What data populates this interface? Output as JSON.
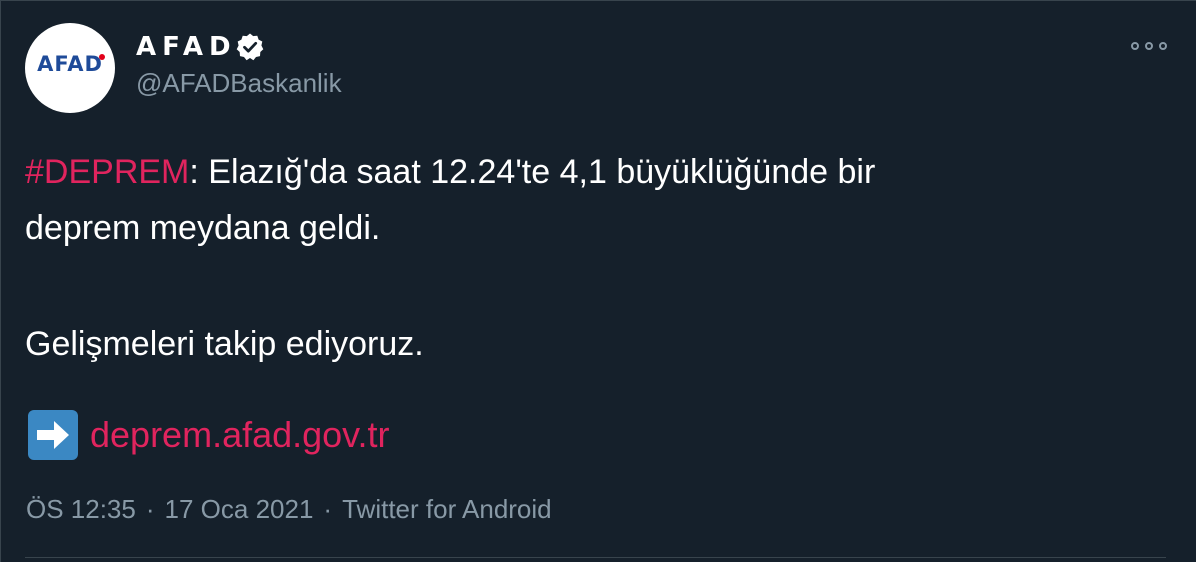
{
  "author": {
    "display_name": "AFAD",
    "handle": "@AFADBaskanlik",
    "avatar_text": "AFAD",
    "verified": true
  },
  "tweet": {
    "hashtag": "#DEPREM",
    "line1_rest": ": Elazığ'da saat 12.24'te 4,1 büyüklüğünde bir",
    "line2": "deprem meydana geldi.",
    "paragraph2": "Gelişmeleri takip ediyoruz.",
    "link_emoji": "right-arrow-emoji",
    "link_text": "deprem.afad.gov.tr"
  },
  "meta": {
    "time": "ÖS 12:35",
    "separator": "·",
    "date": "17 Oca 2021",
    "source": "Twitter for Android"
  },
  "colors": {
    "background": "#15202b",
    "accent": "#e0245e",
    "muted": "#8899a6",
    "text": "#ffffff"
  }
}
